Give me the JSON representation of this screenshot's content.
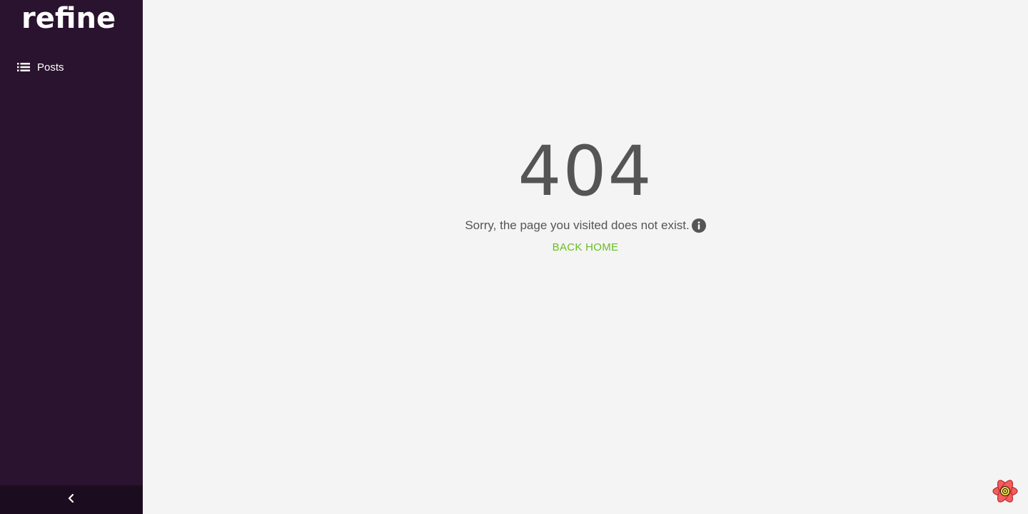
{
  "sidebar": {
    "logo_text": "refine",
    "items": [
      {
        "label": "Posts",
        "icon": "list-icon"
      }
    ],
    "collapse_icon": "chevron-left-icon"
  },
  "error": {
    "code": "404",
    "message": "Sorry, the page you visited does not exist.",
    "info_icon": "info-icon",
    "back_home_label": "BACK HOME"
  },
  "colors": {
    "sidebar_bg": "#2a132e",
    "collapse_bg": "#1c0c1f",
    "main_bg": "#f4f4f4",
    "text_gray": "#555555",
    "accent_green": "#67be23"
  },
  "devtools": {
    "icon": "react-devtools-icon"
  }
}
